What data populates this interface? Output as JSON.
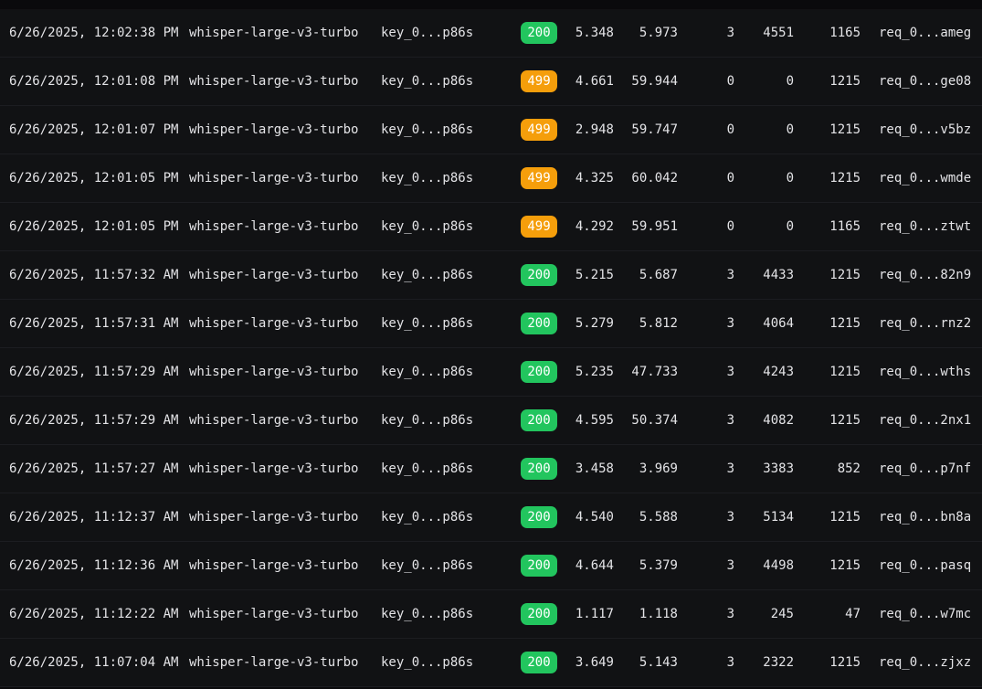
{
  "colors": {
    "status_ok": "#22c55e",
    "status_warn": "#f59e0b",
    "row_bg": "#111214"
  },
  "rows": [
    {
      "time": "6/26/2025, 12:02:38 PM",
      "model": "whisper-large-v3-turbo",
      "key": "key_0...p86s",
      "status": "200",
      "status_kind": "ok",
      "n1": "5.348",
      "n2": "5.973",
      "n3": "3",
      "n4": "4551",
      "n5": "1165",
      "req": "req_0...ameg"
    },
    {
      "time": "6/26/2025, 12:01:08 PM",
      "model": "whisper-large-v3-turbo",
      "key": "key_0...p86s",
      "status": "499",
      "status_kind": "warn",
      "n1": "4.661",
      "n2": "59.944",
      "n3": "0",
      "n4": "0",
      "n5": "1215",
      "req": "req_0...ge08"
    },
    {
      "time": "6/26/2025, 12:01:07 PM",
      "model": "whisper-large-v3-turbo",
      "key": "key_0...p86s",
      "status": "499",
      "status_kind": "warn",
      "n1": "2.948",
      "n2": "59.747",
      "n3": "0",
      "n4": "0",
      "n5": "1215",
      "req": "req_0...v5bz"
    },
    {
      "time": "6/26/2025, 12:01:05 PM",
      "model": "whisper-large-v3-turbo",
      "key": "key_0...p86s",
      "status": "499",
      "status_kind": "warn",
      "n1": "4.325",
      "n2": "60.042",
      "n3": "0",
      "n4": "0",
      "n5": "1215",
      "req": "req_0...wmde"
    },
    {
      "time": "6/26/2025, 12:01:05 PM",
      "model": "whisper-large-v3-turbo",
      "key": "key_0...p86s",
      "status": "499",
      "status_kind": "warn",
      "n1": "4.292",
      "n2": "59.951",
      "n3": "0",
      "n4": "0",
      "n5": "1165",
      "req": "req_0...ztwt"
    },
    {
      "time": "6/26/2025, 11:57:32 AM",
      "model": "whisper-large-v3-turbo",
      "key": "key_0...p86s",
      "status": "200",
      "status_kind": "ok",
      "n1": "5.215",
      "n2": "5.687",
      "n3": "3",
      "n4": "4433",
      "n5": "1215",
      "req": "req_0...82n9"
    },
    {
      "time": "6/26/2025, 11:57:31 AM",
      "model": "whisper-large-v3-turbo",
      "key": "key_0...p86s",
      "status": "200",
      "status_kind": "ok",
      "n1": "5.279",
      "n2": "5.812",
      "n3": "3",
      "n4": "4064",
      "n5": "1215",
      "req": "req_0...rnz2"
    },
    {
      "time": "6/26/2025, 11:57:29 AM",
      "model": "whisper-large-v3-turbo",
      "key": "key_0...p86s",
      "status": "200",
      "status_kind": "ok",
      "n1": "5.235",
      "n2": "47.733",
      "n3": "3",
      "n4": "4243",
      "n5": "1215",
      "req": "req_0...wths"
    },
    {
      "time": "6/26/2025, 11:57:29 AM",
      "model": "whisper-large-v3-turbo",
      "key": "key_0...p86s",
      "status": "200",
      "status_kind": "ok",
      "n1": "4.595",
      "n2": "50.374",
      "n3": "3",
      "n4": "4082",
      "n5": "1215",
      "req": "req_0...2nx1"
    },
    {
      "time": "6/26/2025, 11:57:27 AM",
      "model": "whisper-large-v3-turbo",
      "key": "key_0...p86s",
      "status": "200",
      "status_kind": "ok",
      "n1": "3.458",
      "n2": "3.969",
      "n3": "3",
      "n4": "3383",
      "n5": "852",
      "req": "req_0...p7nf"
    },
    {
      "time": "6/26/2025, 11:12:37 AM",
      "model": "whisper-large-v3-turbo",
      "key": "key_0...p86s",
      "status": "200",
      "status_kind": "ok",
      "n1": "4.540",
      "n2": "5.588",
      "n3": "3",
      "n4": "5134",
      "n5": "1215",
      "req": "req_0...bn8a"
    },
    {
      "time": "6/26/2025, 11:12:36 AM",
      "model": "whisper-large-v3-turbo",
      "key": "key_0...p86s",
      "status": "200",
      "status_kind": "ok",
      "n1": "4.644",
      "n2": "5.379",
      "n3": "3",
      "n4": "4498",
      "n5": "1215",
      "req": "req_0...pasq"
    },
    {
      "time": "6/26/2025, 11:12:22 AM",
      "model": "whisper-large-v3-turbo",
      "key": "key_0...p86s",
      "status": "200",
      "status_kind": "ok",
      "n1": "1.117",
      "n2": "1.118",
      "n3": "3",
      "n4": "245",
      "n5": "47",
      "req": "req_0...w7mc"
    },
    {
      "time": "6/26/2025, 11:07:04 AM",
      "model": "whisper-large-v3-turbo",
      "key": "key_0...p86s",
      "status": "200",
      "status_kind": "ok",
      "n1": "3.649",
      "n2": "5.143",
      "n3": "3",
      "n4": "2322",
      "n5": "1215",
      "req": "req_0...zjxz"
    }
  ]
}
